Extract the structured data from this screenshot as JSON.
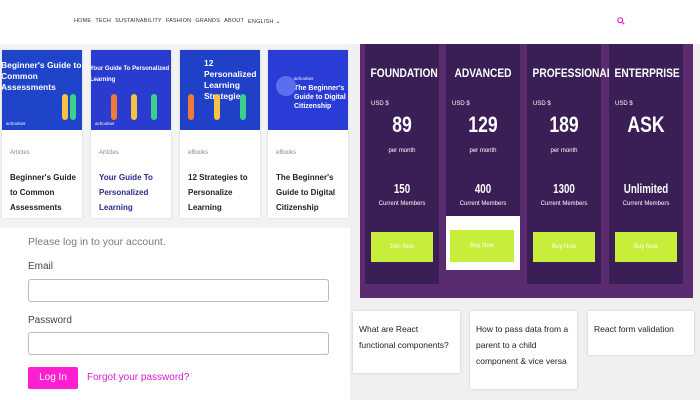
{
  "nav": {
    "items": [
      "HOME",
      "TECH",
      "SUSTAINABILITY",
      "FASHION",
      "GRANDS",
      "ABOUT",
      "ENGLISH"
    ],
    "search_icon": "search-icon",
    "accent": "#e91ed2"
  },
  "cards": [
    {
      "thumb_title": "Beginner's Guide to Common Assessments",
      "brand": "achoolser",
      "category": "Articles",
      "title": "Beginner's Guide to Common Assessments"
    },
    {
      "thumb_title": "Your Guide To Personalized Learning",
      "brand": "achoolser",
      "category": "Articles",
      "title": "Your Guide To Personalized Learning"
    },
    {
      "thumb_title": "12 Personalized Learning Strategies",
      "brand": "",
      "category": "eBooks",
      "title": "12 Strategies to Personalize Learning"
    },
    {
      "thumb_title": "The Beginner's Guide to Digital Citizenship",
      "brand": "achoolser",
      "category": "eBooks",
      "title": "The Beginner's Guide to Digital Citizenship"
    }
  ],
  "login": {
    "prompt": "Please log in to your account.",
    "email_label": "Email",
    "email_value": "",
    "password_label": "Password",
    "password_value": "",
    "login_button": "Log In",
    "forgot_link": "Forgot your password?"
  },
  "pricing": {
    "currency": "USD $",
    "per": "per month",
    "members_label": "Current Members",
    "plans": [
      {
        "name": "FOUNDATION",
        "price": "89",
        "members": "150",
        "cta": "Join Now"
      },
      {
        "name": "ADVANCED",
        "price": "129",
        "members": "400",
        "cta": "Buy Now"
      },
      {
        "name": "PROFESSIONAL",
        "price": "189",
        "members": "1300",
        "cta": "Buy Now"
      },
      {
        "name": "ENTERPRISE",
        "price": "ASK",
        "members": "Unlimited",
        "cta": "Buy Now"
      }
    ]
  },
  "questions": [
    "What are React functional components?",
    "How to pass data from a parent to a child component & vice versa",
    "React form validation"
  ]
}
